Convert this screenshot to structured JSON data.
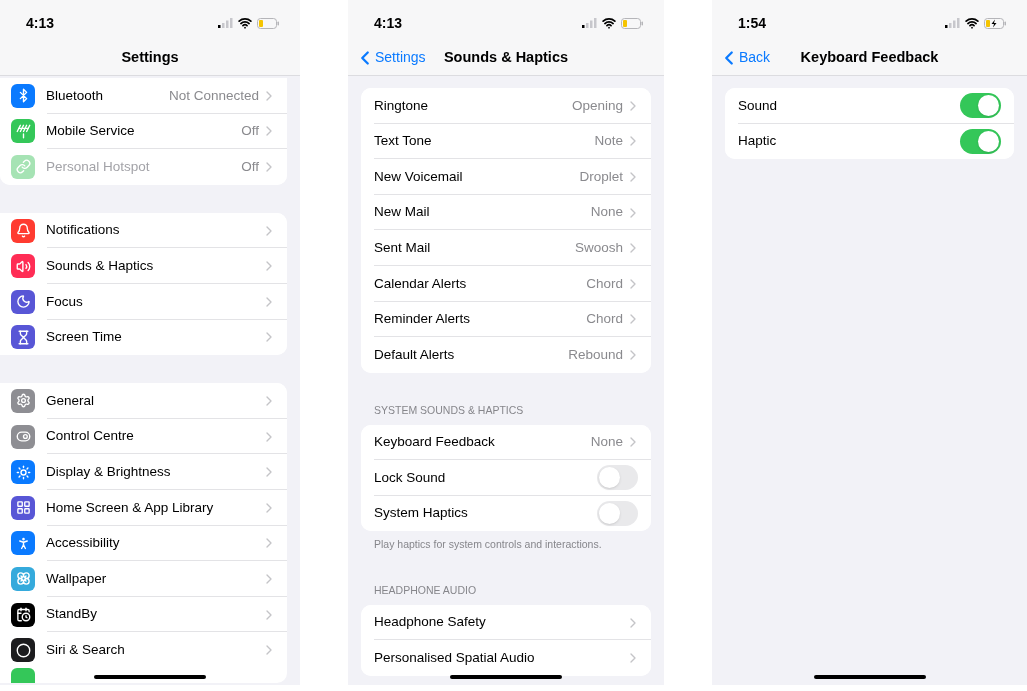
{
  "phones": [
    {
      "status": {
        "time": "4:13",
        "charging": false
      },
      "nav": {
        "title": "Settings"
      },
      "groups": [
        {
          "cut_top": true,
          "rows": [
            {
              "kind": "link",
              "label": "Bluetooth",
              "value": "Not Connected",
              "color": "#0a7aff",
              "disabled": false
            },
            {
              "kind": "link",
              "label": "Mobile Service",
              "value": "Off",
              "color": "#34c759",
              "disabled": false
            },
            {
              "kind": "link",
              "label": "Personal Hotspot",
              "value": "Off",
              "color": "#a6e3b4",
              "disabled": true
            }
          ]
        },
        {
          "cut_top": false,
          "rows": [
            {
              "kind": "link",
              "label": "Notifications",
              "color": "#ff3b30",
              "disabled": false
            },
            {
              "kind": "link",
              "label": "Sounds & Haptics",
              "color": "#ff2d55",
              "disabled": false
            },
            {
              "kind": "link",
              "label": "Focus",
              "color": "#5856d6",
              "disabled": false
            },
            {
              "kind": "link",
              "label": "Screen Time",
              "color": "#5856d6",
              "disabled": false
            }
          ]
        },
        {
          "cut_top": false,
          "rows": [
            {
              "kind": "link",
              "label": "General",
              "color": "#8e8e93",
              "disabled": false
            },
            {
              "kind": "link",
              "label": "Control Centre",
              "color": "#8e8e93",
              "disabled": false
            },
            {
              "kind": "link",
              "label": "Display & Brightness",
              "color": "#0a7aff",
              "disabled": false
            },
            {
              "kind": "link",
              "label": "Home Screen & App Library",
              "color": "#5856d6",
              "disabled": false
            },
            {
              "kind": "link",
              "label": "Accessibility",
              "color": "#0a7aff",
              "disabled": false
            },
            {
              "kind": "link",
              "label": "Wallpaper",
              "color": "#35aadc",
              "disabled": false
            },
            {
              "kind": "link",
              "label": "StandBy",
              "color": "#000000",
              "disabled": false
            },
            {
              "kind": "link",
              "label": "Siri & Search",
              "color": "#1c1c1e",
              "disabled": false
            },
            {
              "kind": "partial",
              "color": "#34c759"
            }
          ]
        }
      ]
    },
    {
      "status": {
        "time": "4:13",
        "charging": false
      },
      "nav": {
        "back": "Settings",
        "title": "Sounds & Haptics"
      },
      "groups": [
        {
          "cut_top": false,
          "rows": [
            {
              "kind": "link",
              "label": "Ringtone",
              "value": "Opening"
            },
            {
              "kind": "link",
              "label": "Text Tone",
              "value": "Note"
            },
            {
              "kind": "link",
              "label": "New Voicemail",
              "value": "Droplet"
            },
            {
              "kind": "link",
              "label": "New Mail",
              "value": "None"
            },
            {
              "kind": "link",
              "label": "Sent Mail",
              "value": "Swoosh"
            },
            {
              "kind": "link",
              "label": "Calendar Alerts",
              "value": "Chord"
            },
            {
              "kind": "link",
              "label": "Reminder Alerts",
              "value": "Chord"
            },
            {
              "kind": "link",
              "label": "Default Alerts",
              "value": "Rebound"
            }
          ]
        },
        {
          "cut_top": false,
          "header": "SYSTEM SOUNDS & HAPTICS",
          "footer": "Play haptics for system controls and interactions.",
          "rows": [
            {
              "kind": "link",
              "label": "Keyboard Feedback",
              "value": "None"
            },
            {
              "kind": "toggle",
              "label": "Lock Sound",
              "on": false
            },
            {
              "kind": "toggle",
              "label": "System Haptics",
              "on": false
            }
          ]
        },
        {
          "cut_top": false,
          "header": "HEADPHONE AUDIO",
          "rows": [
            {
              "kind": "link",
              "label": "Headphone Safety"
            },
            {
              "kind": "link",
              "label": "Personalised Spatial Audio"
            }
          ]
        }
      ]
    },
    {
      "status": {
        "time": "1:54",
        "charging": true
      },
      "nav": {
        "back": "Back",
        "title": "Keyboard Feedback"
      },
      "groups": [
        {
          "cut_top": false,
          "rows": [
            {
              "kind": "toggle",
              "label": "Sound",
              "on": true
            },
            {
              "kind": "toggle",
              "label": "Haptic",
              "on": true
            }
          ]
        }
      ]
    }
  ]
}
